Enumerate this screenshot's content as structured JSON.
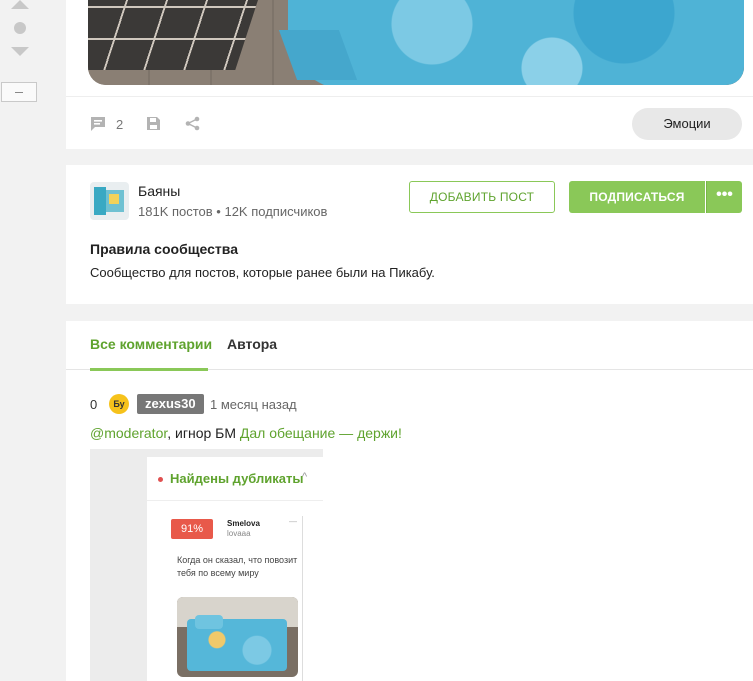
{
  "post": {
    "comments_count": "2",
    "emotions_label": "Эмоции"
  },
  "community": {
    "name": "Баяны",
    "stats": "181K постов • 12K подписчиков",
    "add_post_label": "ДОБАВИТЬ ПОСТ",
    "subscribe_label": "ПОДПИСАТЬСЯ",
    "more_label": "•••",
    "rules_title": "Правила сообщества",
    "rules_text": "Сообщество для постов, которые ранее были на Пикабу."
  },
  "comments": {
    "tabs": [
      {
        "label": "Все комментарии"
      },
      {
        "label": "Автора"
      }
    ],
    "items": [
      {
        "rating": "0",
        "avatar_text": "Бу",
        "username": "zexus30",
        "time": "1 месяц назад",
        "mention": "@moderator",
        "text": ", игнор БМ ",
        "link_text": "Дал обещание — держи!",
        "embed": {
          "title": "Найдены дубликаты",
          "chevron": "^",
          "percent": "91%",
          "user": "Smelova",
          "handle": "lovaaa",
          "close": "—",
          "caption": "Когда он сказал, что повозит тебя по всему миру"
        }
      }
    ]
  },
  "colors": {
    "accent": "#8ac858",
    "accent_text": "#5fa32e",
    "badge_red": "#e8594a"
  }
}
